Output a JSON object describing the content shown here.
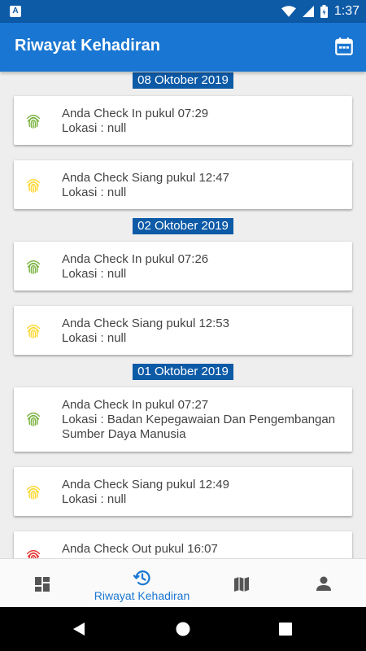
{
  "status_bar": {
    "time": "1:37",
    "notification_icon": "A"
  },
  "app_bar": {
    "title": "Riwayat Kehadiran",
    "calendar_icon": "calendar-icon"
  },
  "colors": {
    "primary": "#1976d2",
    "primary_dark": "#0d5aa7",
    "check_in": "#7cb342",
    "check_siang": "#fdd835",
    "check_out": "#e53935"
  },
  "groups": [
    {
      "date": "08 Oktober 2019",
      "items": [
        {
          "line1": "Anda Check In pukul 07:29",
          "line2": "Lokasi : null",
          "status": "check-in"
        },
        {
          "line1": "Anda Check Siang pukul 12:47",
          "line2": "Lokasi : null",
          "status": "check-siang"
        }
      ]
    },
    {
      "date": "02 Oktober 2019",
      "items": [
        {
          "line1": "Anda Check In pukul 07:26",
          "line2": "Lokasi : null",
          "status": "check-in"
        },
        {
          "line1": "Anda Check Siang pukul 12:53",
          "line2": "Lokasi : null",
          "status": "check-siang"
        }
      ]
    },
    {
      "date": "01 Oktober 2019",
      "items": [
        {
          "line1": "Anda Check In pukul 07:27",
          "line2": "Lokasi : Badan Kepegawaian Dan Pengembangan",
          "line3": "Sumber Daya Manusia",
          "status": "check-in"
        },
        {
          "line1": "Anda Check Siang pukul 12:49",
          "line2": "Lokasi : null",
          "status": "check-siang"
        },
        {
          "line1": "Anda Check Out pukul 16:07",
          "status": "check-out"
        }
      ]
    }
  ],
  "bottom_nav": {
    "items": [
      {
        "icon": "dashboard-icon"
      },
      {
        "icon": "history-icon",
        "label": "Riwayat Kehadiran",
        "active": true
      },
      {
        "icon": "map-icon"
      },
      {
        "icon": "person-icon"
      }
    ]
  }
}
